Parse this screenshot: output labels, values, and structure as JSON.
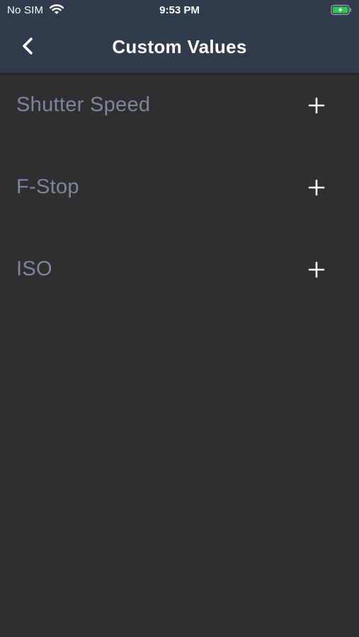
{
  "status_bar": {
    "carrier": "No SIM",
    "time": "9:53 PM",
    "battery_color": "#33c759"
  },
  "nav": {
    "title": "Custom Values",
    "back_icon": "chevron-left-icon"
  },
  "list": {
    "items": [
      {
        "label": "Shutter Speed",
        "action_icon": "plus-icon"
      },
      {
        "label": "F-Stop",
        "action_icon": "plus-icon"
      },
      {
        "label": "ISO",
        "action_icon": "plus-icon"
      }
    ]
  },
  "colors": {
    "header_background": "#323b4b",
    "page_background": "#2f2f2f",
    "label_text": "#7b859c",
    "icon": "#ffffff"
  }
}
